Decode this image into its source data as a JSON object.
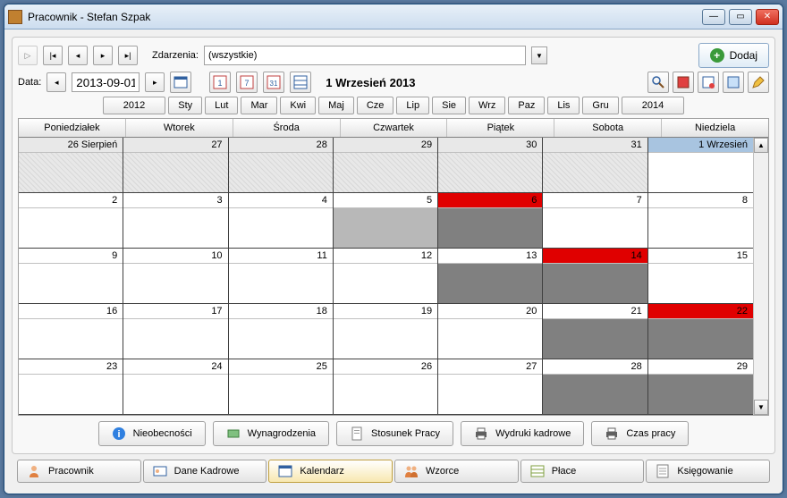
{
  "window": {
    "title": "Pracownik - Stefan Szpak"
  },
  "toolbar": {
    "events_label": "Zdarzenia:",
    "events_value": "(wszystkie)",
    "add_label": "Dodaj",
    "date_label": "Data:",
    "date_value": "2013-09-01",
    "month_title": "1 Wrzesień 2013"
  },
  "nav": {
    "prev_year": "2012",
    "next_year": "2014",
    "months": [
      "Sty",
      "Lut",
      "Mar",
      "Kwi",
      "Maj",
      "Cze",
      "Lip",
      "Sie",
      "Wrz",
      "Paz",
      "Lis",
      "Gru"
    ]
  },
  "calendar": {
    "weekdays": [
      "Poniedziałek",
      "Wtorek",
      "Środa",
      "Czwartek",
      "Piątek",
      "Sobota",
      "Niedziela"
    ],
    "cells": [
      {
        "label": "26 Sierpień",
        "kind": "prev"
      },
      {
        "label": "27",
        "kind": "prev"
      },
      {
        "label": "28",
        "kind": "prev"
      },
      {
        "label": "29",
        "kind": "prev"
      },
      {
        "label": "30",
        "kind": "prev"
      },
      {
        "label": "31",
        "kind": "prev"
      },
      {
        "label": "1 Wrzesień",
        "kind": "first"
      },
      {
        "label": "2",
        "kind": "normal"
      },
      {
        "label": "3",
        "kind": "normal"
      },
      {
        "label": "4",
        "kind": "normal"
      },
      {
        "label": "5",
        "kind": "lightgrey"
      },
      {
        "label": "6",
        "kind": "redgrey"
      },
      {
        "label": "7",
        "kind": "normal"
      },
      {
        "label": "8",
        "kind": "normal"
      },
      {
        "label": "9",
        "kind": "normal"
      },
      {
        "label": "10",
        "kind": "normal"
      },
      {
        "label": "11",
        "kind": "normal"
      },
      {
        "label": "12",
        "kind": "normal"
      },
      {
        "label": "13",
        "kind": "grey"
      },
      {
        "label": "14",
        "kind": "redgrey"
      },
      {
        "label": "15",
        "kind": "normal"
      },
      {
        "label": "16",
        "kind": "normal"
      },
      {
        "label": "17",
        "kind": "normal"
      },
      {
        "label": "18",
        "kind": "normal"
      },
      {
        "label": "19",
        "kind": "normal"
      },
      {
        "label": "20",
        "kind": "normal"
      },
      {
        "label": "21",
        "kind": "grey"
      },
      {
        "label": "22",
        "kind": "redgrey"
      },
      {
        "label": "23",
        "kind": "normal"
      },
      {
        "label": "24",
        "kind": "normal"
      },
      {
        "label": "25",
        "kind": "normal"
      },
      {
        "label": "26",
        "kind": "normal"
      },
      {
        "label": "27",
        "kind": "normal"
      },
      {
        "label": "28",
        "kind": "grey"
      },
      {
        "label": "29",
        "kind": "grey"
      }
    ]
  },
  "middle_buttons": [
    {
      "label": "Nieobecności",
      "icon": "info"
    },
    {
      "label": "Wynagrodzenia",
      "icon": "money"
    },
    {
      "label": "Stosunek Pracy",
      "icon": "doc"
    },
    {
      "label": "Wydruki kadrowe",
      "icon": "print"
    },
    {
      "label": "Czas pracy",
      "icon": "print"
    }
  ],
  "tabs": [
    {
      "label": "Pracownik",
      "icon": "person"
    },
    {
      "label": "Dane Kadrowe",
      "icon": "card"
    },
    {
      "label": "Kalendarz",
      "icon": "calendar",
      "active": true
    },
    {
      "label": "Wzorce",
      "icon": "people"
    },
    {
      "label": "Płace",
      "icon": "table"
    },
    {
      "label": "Księgowanie",
      "icon": "ledger"
    }
  ]
}
